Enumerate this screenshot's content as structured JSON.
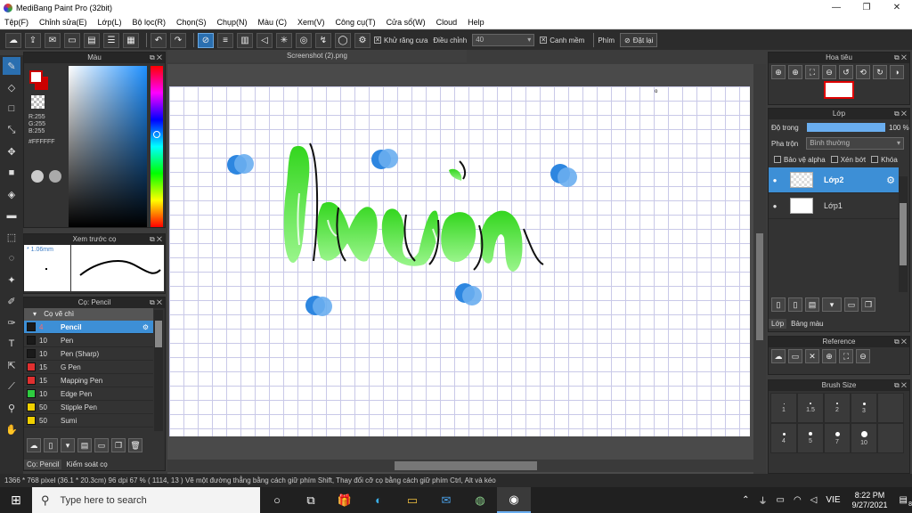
{
  "window": {
    "title": "MediBang Paint Pro (32bit)",
    "minimize": "—",
    "maximize": "❐",
    "close": "✕"
  },
  "menu": [
    "Tệp(F)",
    "Chỉnh sửa(E)",
    "Lớp(L)",
    "Bộ lọc(R)",
    "Chọn(S)",
    "Chụp(N)",
    "Màu (C)",
    "Xem(V)",
    "Công cụ(T)",
    "Cửa sổ(W)",
    "Cloud",
    "Help"
  ],
  "toolbar": {
    "antialias_label": "Khử răng cưa",
    "antialias_checked": "✕",
    "adjust_label": "Điều chỉnh",
    "adjust_value": "40",
    "edge_label": "Canh mềm",
    "edge_checked": "✕",
    "key_label": "Phím",
    "reset_label": "Đặt lại"
  },
  "color_panel": {
    "title": "Màu",
    "rgb": "R:255\nG:255\nB:255",
    "hex": "#FFFFFF"
  },
  "preview_panel": {
    "title": "Xem trước cọ",
    "size": "* 1.06mm"
  },
  "brush_panel": {
    "title": "Cọ: Pencil",
    "group": "Cọ vẽ chì",
    "items": [
      {
        "size": "4",
        "name": "Pencil",
        "color": "#1a1a1a"
      },
      {
        "size": "10",
        "name": "Pen",
        "color": "#1a1a1a"
      },
      {
        "size": "10",
        "name": "Pen (Sharp)",
        "color": "#1a1a1a"
      },
      {
        "size": "15",
        "name": "G Pen",
        "color": "#e03030"
      },
      {
        "size": "15",
        "name": "Mapping Pen",
        "color": "#e03030"
      },
      {
        "size": "10",
        "name": "Edge Pen",
        "color": "#2ecc40"
      },
      {
        "size": "50",
        "name": "Stipple Pen",
        "color": "#f0d000"
      },
      {
        "size": "50",
        "name": "Sumi",
        "color": "#f0d000"
      }
    ],
    "tabs": [
      "Cọ: Pencil",
      "Kiểm soát cọ"
    ]
  },
  "document": {
    "tab": "Screenshot (2).png",
    "text": "lwồn"
  },
  "navigator_panel": {
    "title": "Hoa tiêu"
  },
  "layer_panel": {
    "title": "Lớp",
    "opacity_label": "Độ trong",
    "opacity_value": "100 %",
    "opacity": 1.0,
    "blend_label": "Pha trộn",
    "blend_value": "Bình thường",
    "protect_alpha": "Bảo vệ alpha",
    "clipping": "Xén bớt",
    "lock": "Khóa",
    "layers": [
      {
        "name": "Lớp2"
      },
      {
        "name": "Lớp1"
      }
    ],
    "tabs": [
      "Lớp",
      "Bảng màu"
    ]
  },
  "reference_panel": {
    "title": "Reference"
  },
  "brushsize_panel": {
    "title": "Brush Size",
    "sizes": [
      "1",
      "1.5",
      "2",
      "3",
      "4",
      "5",
      "7",
      "10"
    ]
  },
  "status": "1366 * 768 pixel   (36.1 * 20.3cm)   96 dpi   67 %   ( 1114, 13 )   Vẽ một đường thẳng bằng cách giữ phím Shift, Thay đổi cỡ cọ bằng cách giữ phím Ctrl, Alt và kéo",
  "taskbar": {
    "search": "Type here to search",
    "lang": "VIE",
    "time": "8:22 PM",
    "date": "9/27/2021",
    "notif": "8"
  }
}
